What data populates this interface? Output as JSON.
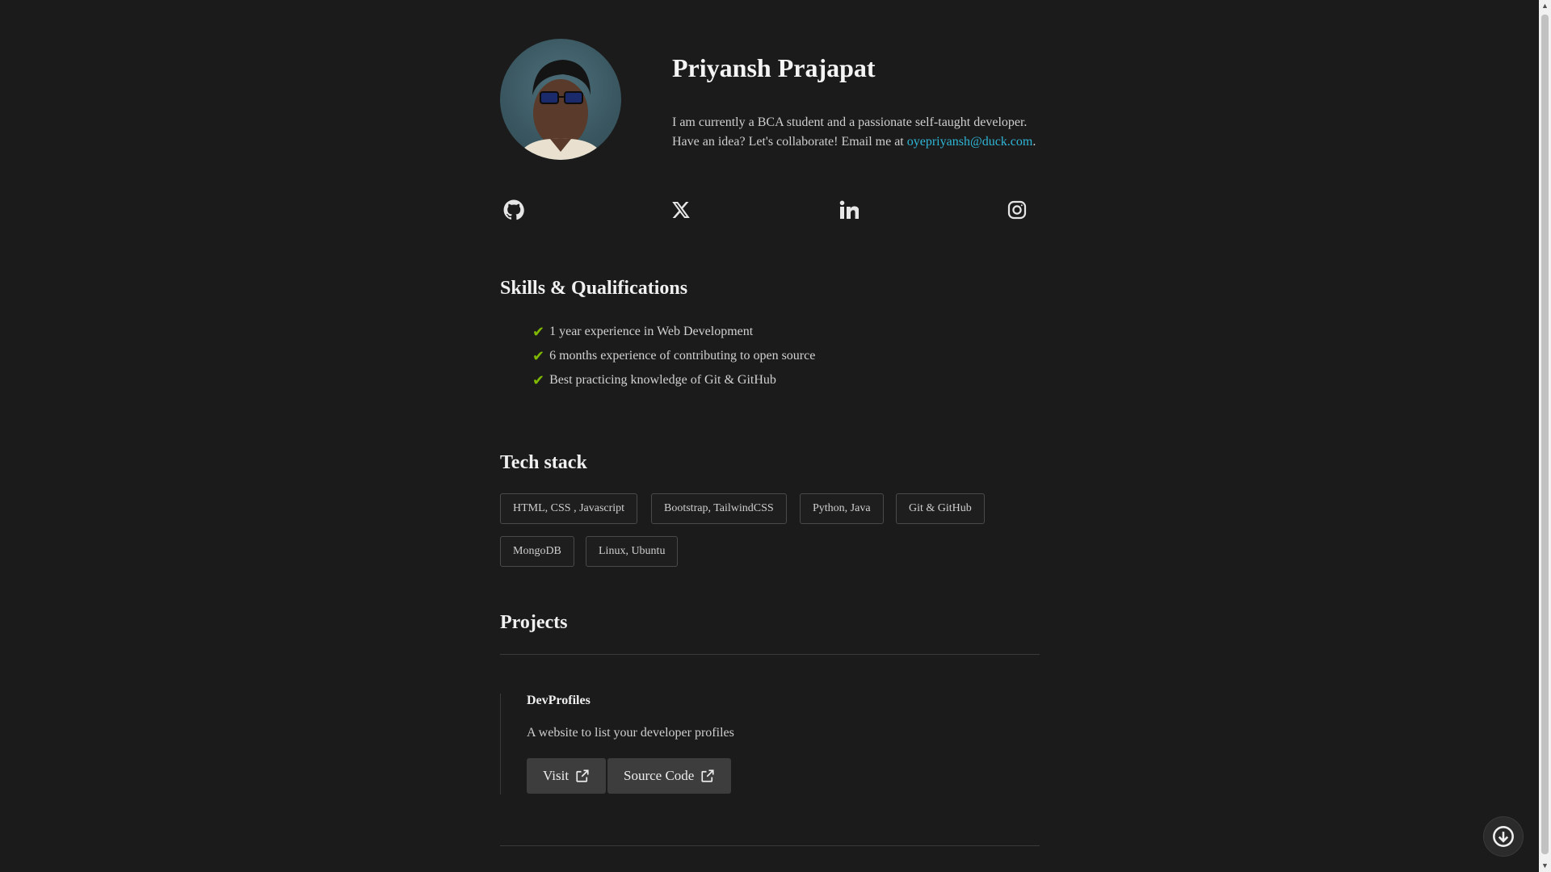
{
  "profile": {
    "name": "Priyansh Prajapat",
    "bio_line1": "I am currently a BCA student and a passionate self-taught developer.",
    "bio_line2_prefix": "Have an idea? Let's collaborate! Email me at ",
    "email": "oyepriyansh@duck.com",
    "bio_suffix": "."
  },
  "socials": [
    "github-icon",
    "x-icon",
    "linkedin-icon",
    "instagram-icon"
  ],
  "skills": {
    "title": "Skills & Qualifications",
    "items": [
      "1 year experience in Web Development",
      "6 months experience of contributing to open source",
      "Best practicing knowledge of Git & GitHub"
    ]
  },
  "tech": {
    "title": "Tech stack",
    "tags": [
      "HTML, CSS , Javascript",
      "Bootstrap, TailwindCSS",
      "Python, Java",
      "Git & GitHub",
      "MongoDB",
      "Linux, Ubuntu"
    ]
  },
  "projects": {
    "title": "Projects",
    "items": [
      {
        "name": "DevProfiles",
        "description": "A website to list your developer profiles",
        "visit_label": "Visit",
        "source_label": "Source Code"
      }
    ]
  },
  "colors": {
    "background": "#1b1b1b",
    "link": "#2fb6d6",
    "check": "#7fb800"
  }
}
